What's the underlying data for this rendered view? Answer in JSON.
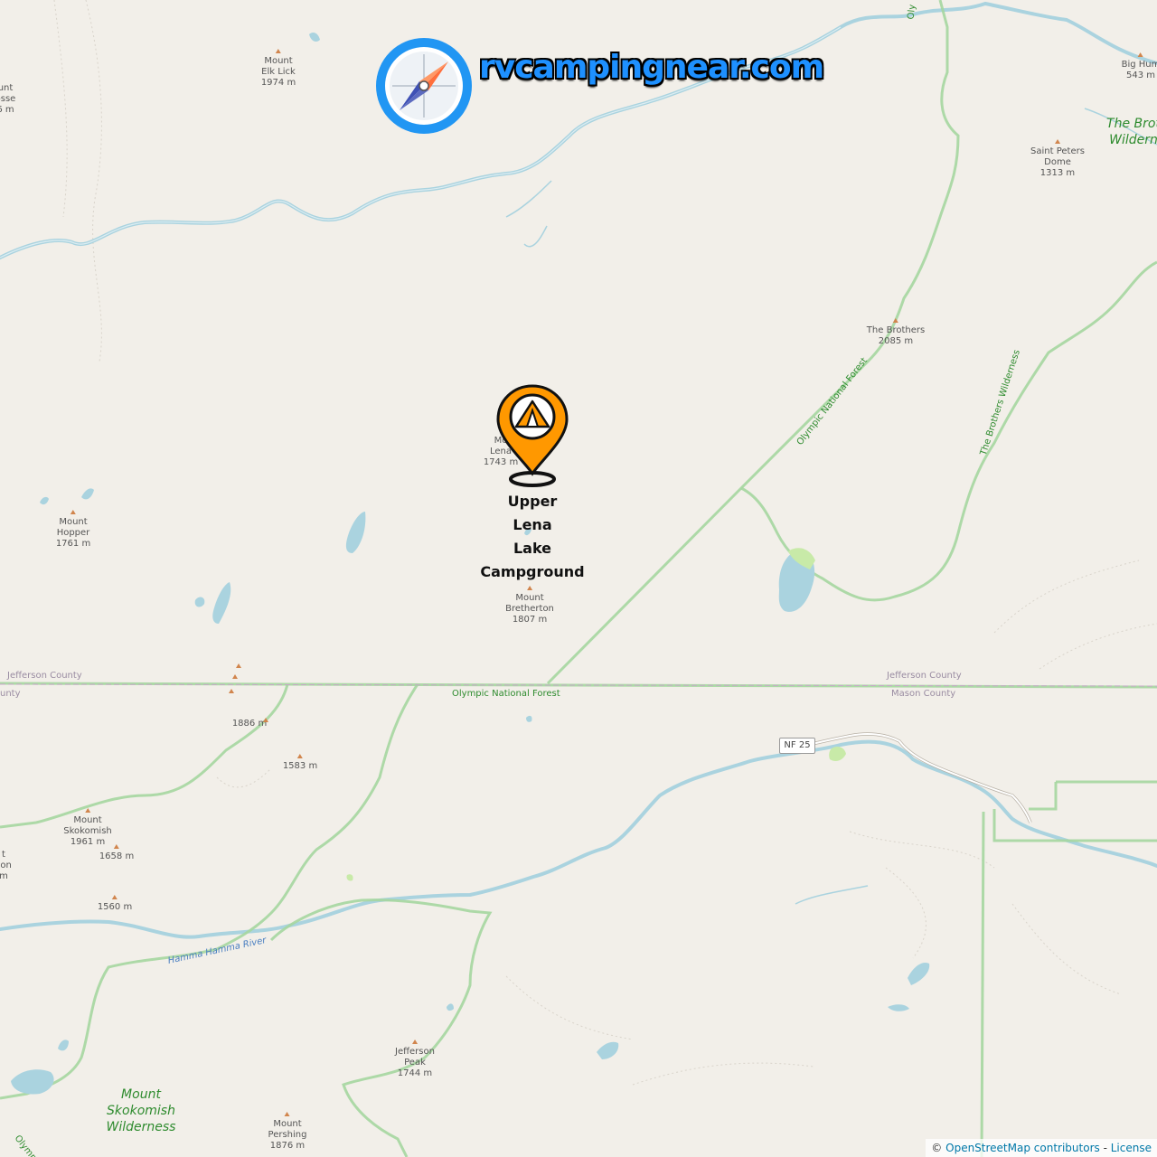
{
  "site": {
    "logo_text": "rvcampingnear.com",
    "logo_icon": "compass-icon"
  },
  "marker": {
    "icon": "tent-icon",
    "label_lines": [
      "Upper",
      "Lena",
      "Lake",
      "Campground"
    ]
  },
  "peaks": {
    "elk_lick": [
      "Mount",
      "Elk Lick",
      "1974 m"
    ],
    "crosse": [
      "unt",
      "osse",
      "6 m"
    ],
    "big_hump": [
      "Big Hum",
      "543 m"
    ],
    "saint_peters": [
      "Saint Peters",
      "Dome",
      "1313 m"
    ],
    "brothers": [
      "The Brothers",
      "2085 m"
    ],
    "lena": [
      "Mo",
      "Lena",
      "1743 m"
    ],
    "hopper": [
      "Mount",
      "Hopper",
      "1761 m"
    ],
    "bretherton": [
      "Mount",
      "Bretherton",
      "1807 m"
    ],
    "p1886": [
      "1886 m"
    ],
    "p1583": [
      "1583 m"
    ],
    "skokomish": [
      "Mount",
      "Skokomish",
      "1961 m"
    ],
    "p1658": [
      "1658 m"
    ],
    "p1560": [
      "1560 m"
    ],
    "left_edge": [
      "t",
      "son",
      "m"
    ],
    "jefferson_peak": [
      "Jefferson",
      "Peak",
      "1744 m"
    ],
    "pershing": [
      "Mount",
      "Pershing",
      "1876 m"
    ]
  },
  "wilderness": {
    "brothers_top": [
      "The Brot",
      "Wildern"
    ],
    "skokomish": [
      "Mount",
      "Skokomish",
      "Wilderness"
    ]
  },
  "labels": {
    "jefferson_county_left": "Jefferson County",
    "county_left_edge": "unty",
    "jefferson_county_right": "Jefferson County",
    "mason_county": "Mason County",
    "onf_bottom": "Olympic National Forest",
    "onf_diag": "Olympic National Forest",
    "brothers_wilderness_diag": "The Brothers Wilderness",
    "hamma_river": "Hamma Hamma River",
    "olympic_top_edge": "Oly",
    "olympic_bottom_edge": "Olympic N",
    "road_shield": "NF 25"
  },
  "attribution": {
    "copyright": "©",
    "osm": "OpenStreetMap contributors",
    "separator": "-",
    "license": "License"
  }
}
